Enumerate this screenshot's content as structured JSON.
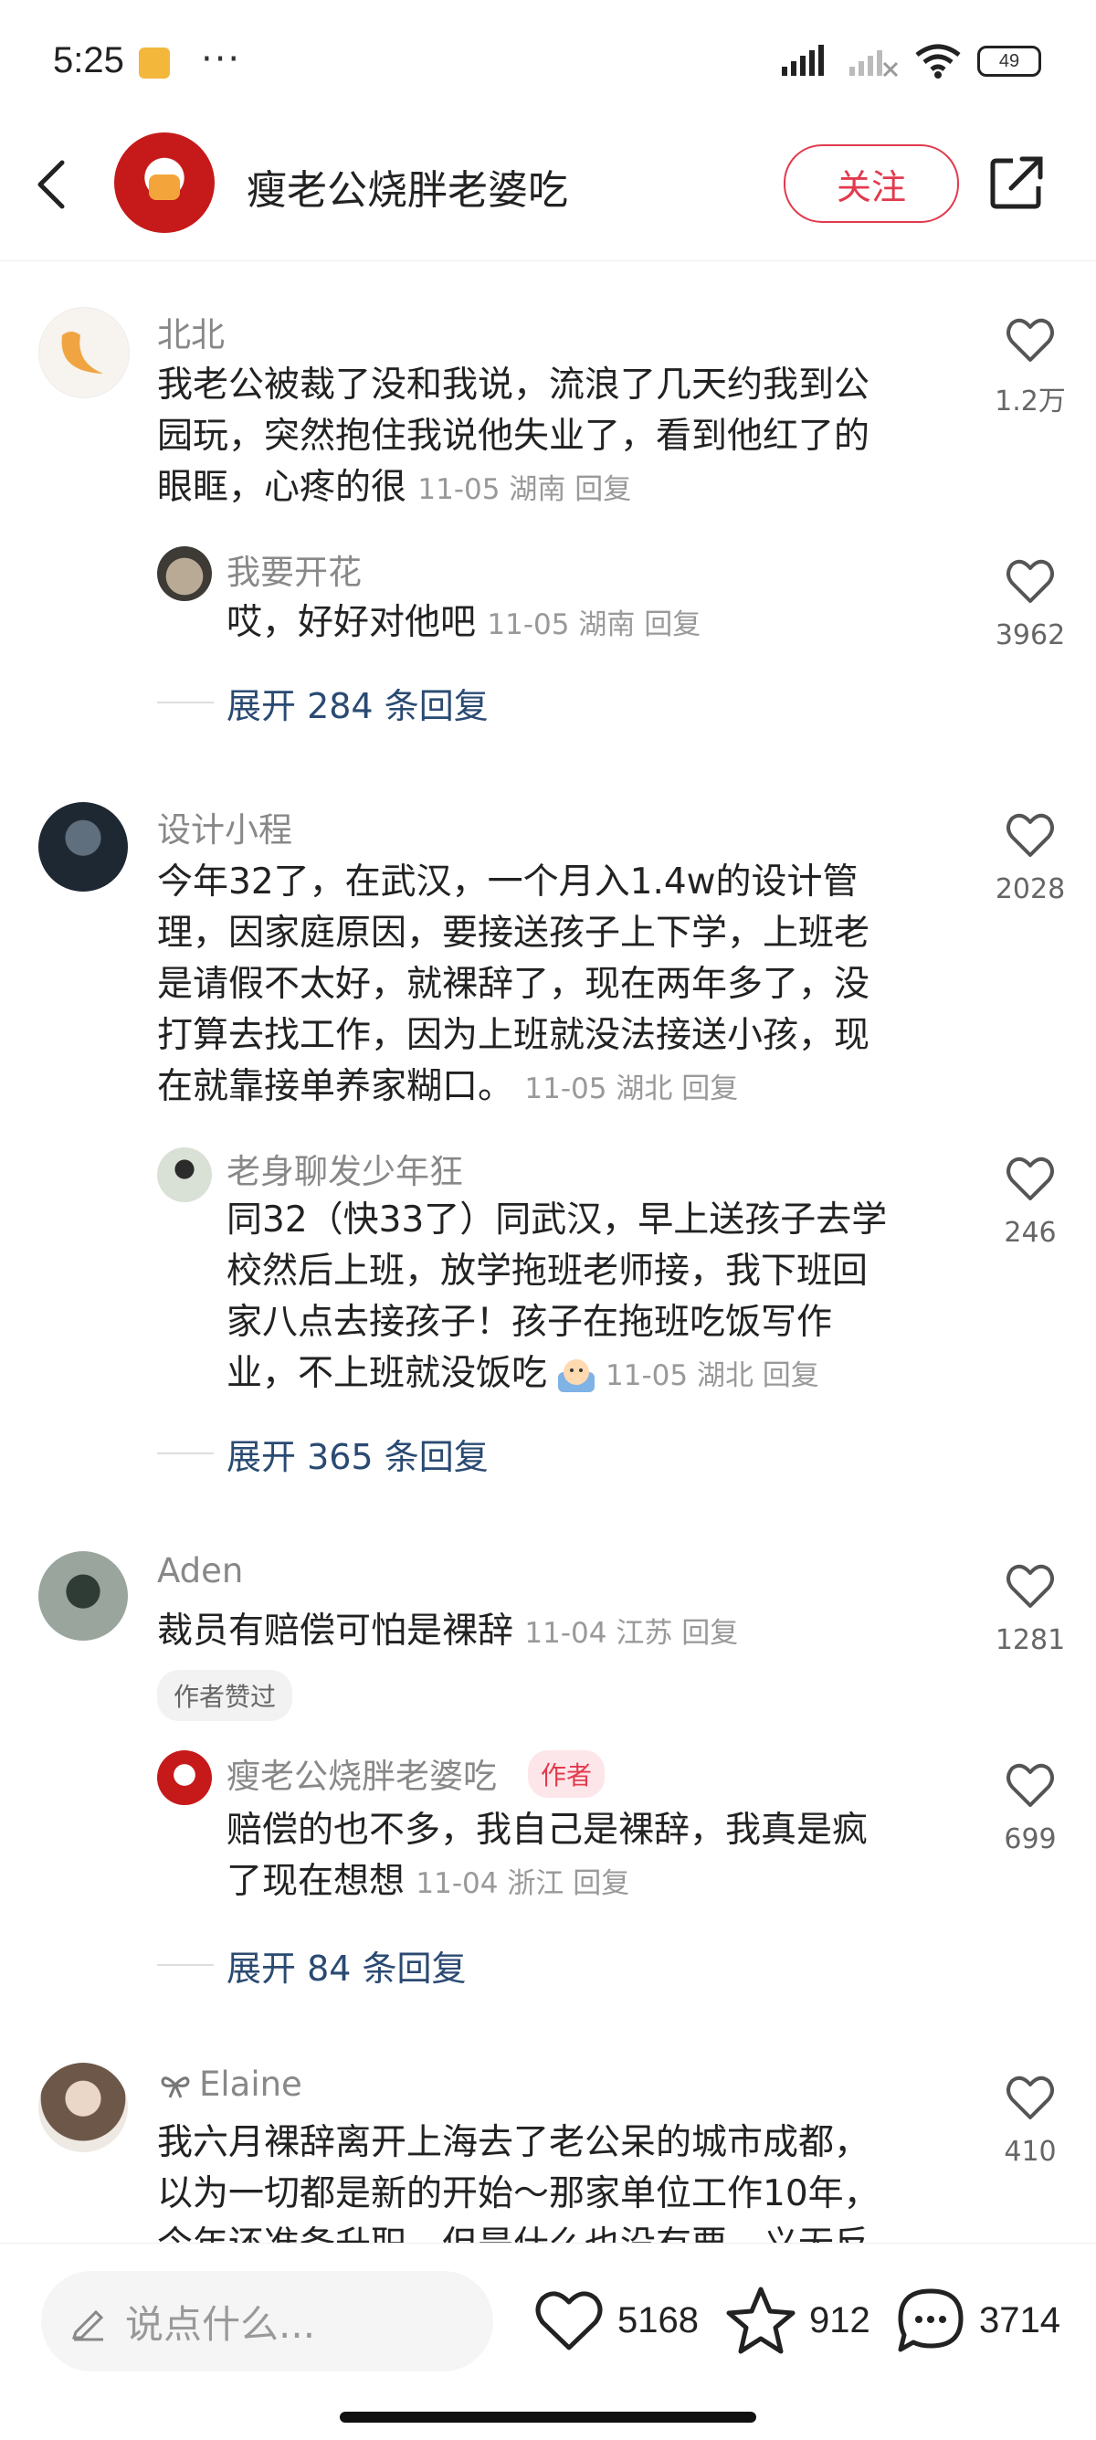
{
  "status_bar": {
    "time": "5:25",
    "dots": "···",
    "battery": "49"
  },
  "header": {
    "author": "瘦老公烧胖老婆吃",
    "follow_label": "关注"
  },
  "comments": [
    {
      "name": "北北",
      "text_lines": [
        "我老公被裁了没和我说，流浪了几天约我到公",
        "园玩，突然抱住我说他失业了，看到他红了的",
        "眼眶，心疼的很"
      ],
      "meta": "11-05 湖南 回复",
      "likes": "1.2万",
      "reply": {
        "name": "我要开花",
        "text": "哎，好好对他吧",
        "meta": "11-05 湖南 回复",
        "likes": "3962"
      },
      "expand": "展开 284 条回复"
    },
    {
      "name": "设计小程",
      "text_lines": [
        "今年32了，在武汉，一个月入1.4w的设计管",
        "理，因家庭原因，要接送孩子上下学，上班老",
        "是请假不太好，就裸辞了，现在两年多了，没",
        "打算去找工作，因为上班就没法接送小孩，现",
        "在就靠接单养家糊口。"
      ],
      "meta": "11-05 湖北 回复",
      "likes": "2028",
      "reply": {
        "name": "老身聊发少年狂",
        "text_lines": [
          "同32（快33了）同武汉，早上送孩子去学",
          "校然后上班，放学拖班老师接，我下班回",
          "家八点去接孩子！孩子在拖班吃饭写作",
          "业，不上班就没饭吃"
        ],
        "meta": "11-05 湖北 回复",
        "likes": "246"
      },
      "expand": "展开 365 条回复"
    },
    {
      "name": "Aden",
      "text": "裁员有赔偿可怕是裸辞",
      "meta": "11-04 江苏 回复",
      "likes": "1281",
      "tag": "作者赞过",
      "reply": {
        "name": "瘦老公烧胖老婆吃",
        "author_tag": "作者",
        "text_lines": [
          "赔偿的也不多，我自己是裸辞，我真是疯",
          "了现在想想"
        ],
        "meta": "11-04 浙江 回复",
        "likes": "699"
      },
      "expand": "展开 84 条回复"
    },
    {
      "name": "Elaine",
      "text_lines": [
        "我六月裸辞离开上海去了老公呆的城市成都，",
        "以为一切都是新的开始～那家单位工作10年，",
        "今年还准备升职，但是什么也没有要，义无反"
      ],
      "likes": "410"
    }
  ],
  "bottom_bar": {
    "input_placeholder": "说点什么...",
    "likes": "5168",
    "stars": "912",
    "comments": "3714"
  }
}
